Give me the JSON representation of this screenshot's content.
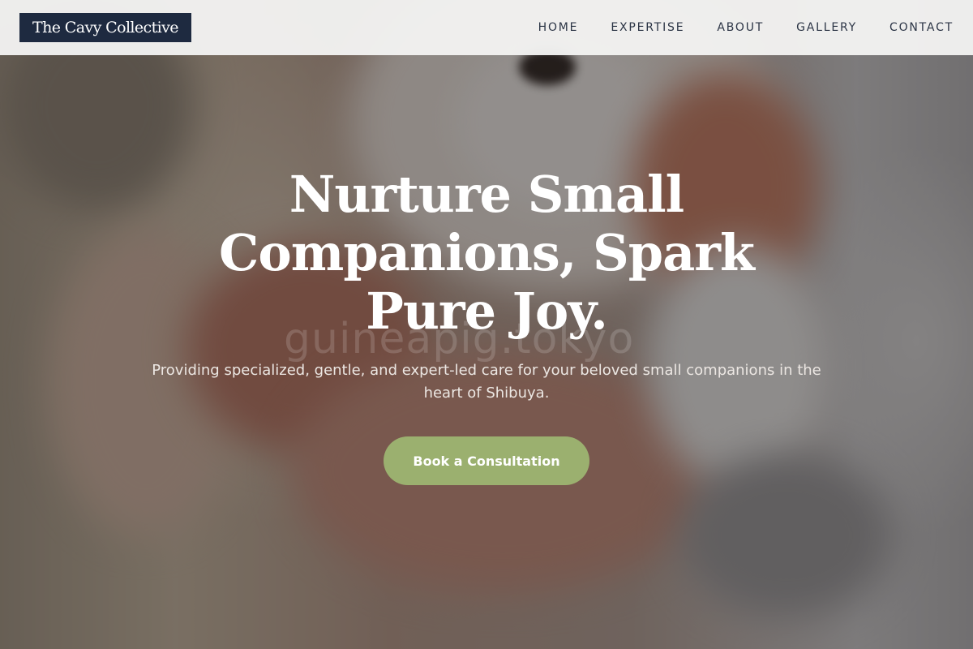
{
  "header": {
    "brand": "The Cavy Collective",
    "nav": [
      {
        "label": "HOME"
      },
      {
        "label": "EXPERTISE"
      },
      {
        "label": "ABOUT"
      },
      {
        "label": "GALLERY"
      },
      {
        "label": "CONTACT"
      }
    ]
  },
  "hero": {
    "headline": "Nurture Small Companions, Spark Pure Joy.",
    "subtitle": "Providing specialized, gentle, and expert-led care for your beloved small companions in the heart of Shibuya.",
    "cta_label": "Book a Consultation",
    "watermark": "guineapig.tokyo"
  },
  "colors": {
    "brand_dark": "#1e2a40",
    "accent_green": "#9bb06f",
    "nav_text": "#2b3445",
    "header_bg": "#f3f2f1"
  }
}
